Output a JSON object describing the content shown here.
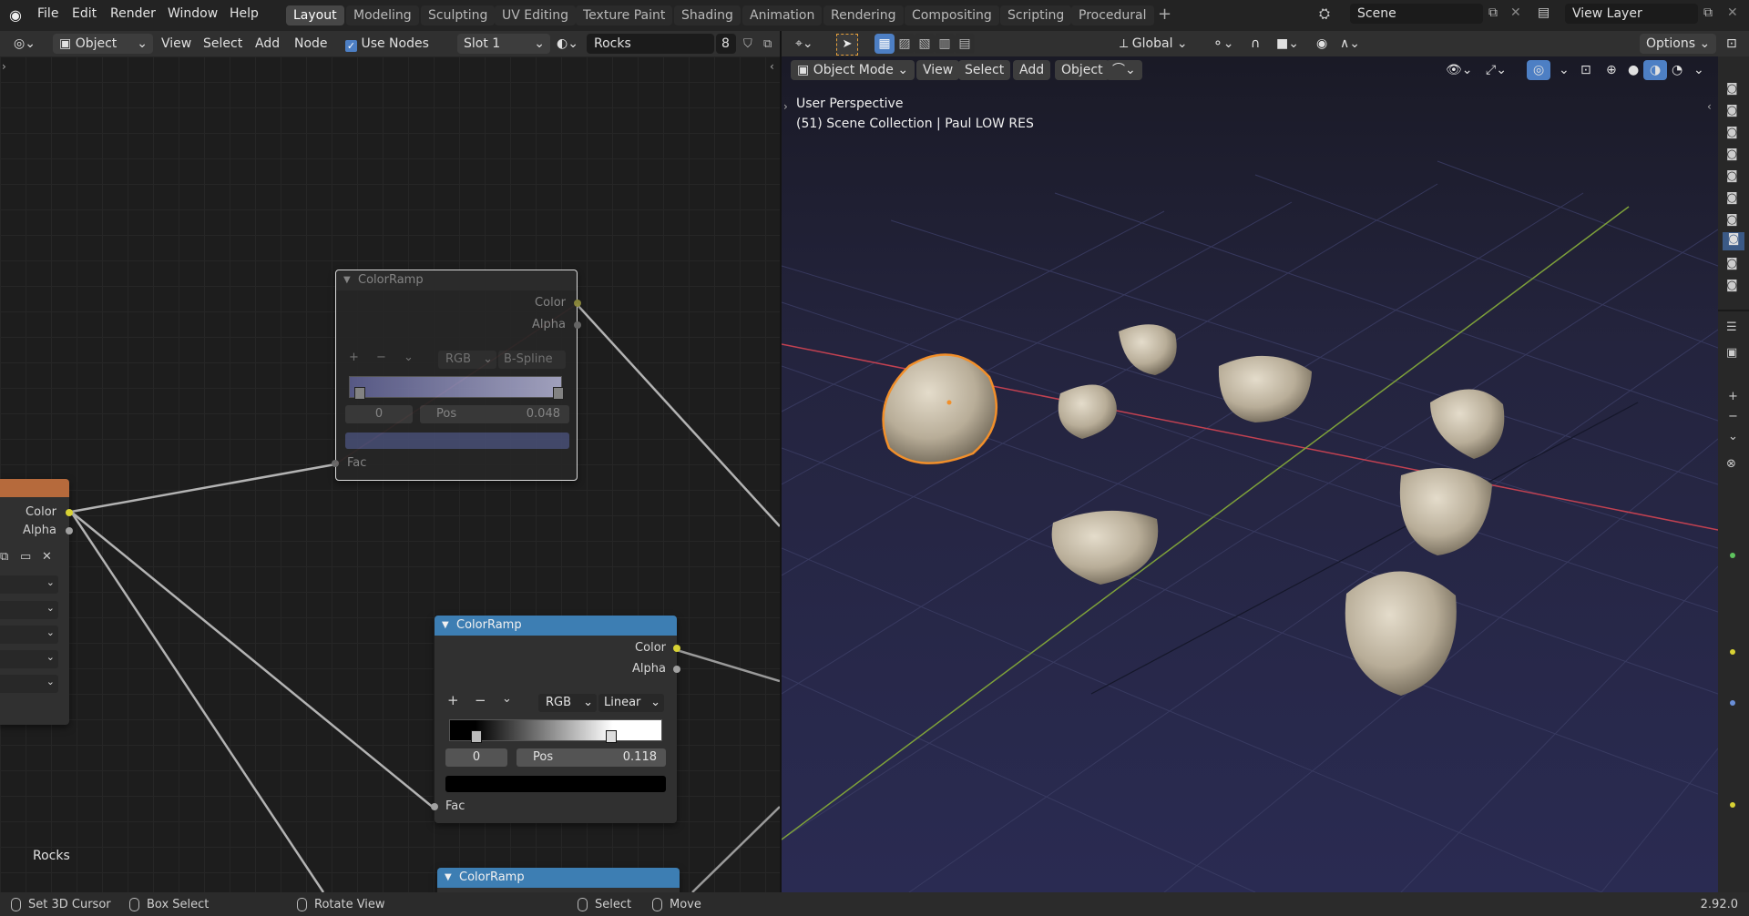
{
  "topbar": {
    "menus": [
      "File",
      "Edit",
      "Render",
      "Window",
      "Help"
    ],
    "workspaces": [
      "Layout",
      "Modeling",
      "Sculpting",
      "UV Editing",
      "Texture Paint",
      "Shading",
      "Animation",
      "Rendering",
      "Compositing",
      "Scripting",
      "Procedural"
    ],
    "active_workspace": "Layout",
    "scene": "Scene",
    "view_layer": "View Layer"
  },
  "node_header": {
    "object_type": "Object",
    "view": "View",
    "select": "Select",
    "add": "Add",
    "node": "Node",
    "use_nodes_label": "Use Nodes",
    "use_nodes_checked": true,
    "slot": "Slot 1",
    "material": "Rocks",
    "material_users": "8"
  },
  "view_header": {
    "transform_orientation": "Global",
    "options": "Options",
    "mode": "Object Mode",
    "view": "View",
    "select": "Select",
    "add": "Add",
    "object": "Object"
  },
  "viewport": {
    "perspective": "User Perspective",
    "collection_info": "(51) Scene Collection | Paul LOW RES",
    "accent_color": "#f28f2a"
  },
  "nodes": {
    "colorramp_1": {
      "title": "ColorRamp",
      "out_color": "Color",
      "out_alpha": "Alpha",
      "color_mode": "RGB",
      "interpolation": "B-Spline",
      "stop_index": "0",
      "pos_label": "Pos",
      "pos_value": "0.048",
      "in_fac": "Fac"
    },
    "colorramp_2": {
      "title": "ColorRamp",
      "out_color": "Color",
      "out_alpha": "Alpha",
      "color_mode": "RGB",
      "interpolation": "Linear",
      "stop_index": "0",
      "pos_label": "Pos",
      "pos_value": "0.118",
      "in_fac": "Fac"
    },
    "colorramp_3": {
      "title": "ColorRamp"
    },
    "texture_node": {
      "out_color": "Color",
      "out_alpha": "Alpha"
    },
    "frame_label": "Rocks"
  },
  "statusbar": {
    "set_cursor": "Set 3D Cursor",
    "box_select": "Box Select",
    "rotate_view": "Rotate View",
    "select": "Select",
    "move": "Move",
    "version": "2.92.0"
  }
}
